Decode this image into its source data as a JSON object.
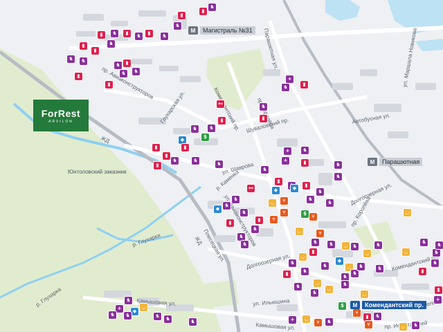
{
  "brand": {
    "name": "ForRest",
    "subtitle": "ARVILON"
  },
  "metro_stations": [
    {
      "name": "Магистраль №31",
      "active": false
    },
    {
      "name": "Парашютная",
      "active": false
    },
    {
      "name": "Комендантский пр.",
      "active": true
    }
  ],
  "metro_icon": "metro-icon",
  "areas": [
    "Юнтоловский заказник"
  ],
  "streets": [
    "пр. Авиаконструкторов",
    "Глухарская ул.",
    "Комендантский пр.",
    "пр. Королёва",
    "Шуваловский пр.",
    "Парашютная ул.",
    "Автобусная ул.",
    "ул. Маршала Новикова",
    "ул. Шаврова",
    "ул. Авиаконструкторов",
    "Долгоозерная ул.",
    "Плесецкая ул.",
    "пр. Королёва",
    "Долгоозерная ул.",
    "Комендантский пр.",
    "ул. Ильюшина",
    "пр. Испытателей",
    "Камышовая ул.",
    "Камышовая ул.",
    "ЖД",
    "ЖД",
    "р. Глухарка",
    "р. Глухарка",
    "р. Каменка",
    "Гаккелевская ул."
  ],
  "legend_colors": {
    "school": "#e0214d",
    "kinder": "#8b2f9c",
    "medical": "#8b2f9c",
    "shop": "#f2b43a",
    "food": "#e85a1e",
    "sport": "#e0214d",
    "bank": "#2f9e45",
    "service": "#2a8ad4",
    "park": "#dde9c8",
    "water": "#8fd0f0",
    "rail": "#b7bcc4"
  },
  "poi_icons": {
    "school": "book-icon",
    "kinder": "rocking-horse-icon",
    "medical": "cross-icon",
    "shop": "basket-icon",
    "food": "cutlery-icon",
    "sport": "dumbbell-icon",
    "bank": "dollar-icon",
    "service": "tag-icon"
  }
}
